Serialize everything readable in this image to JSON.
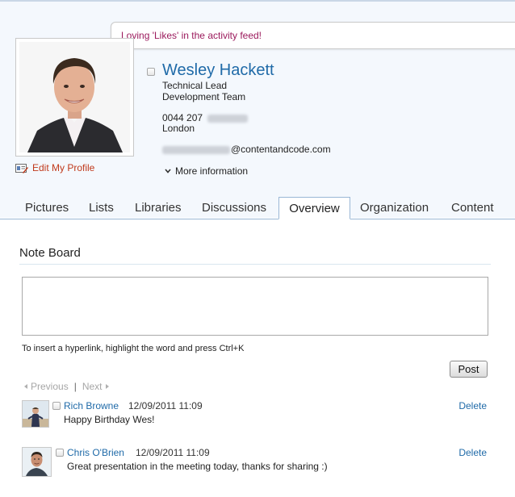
{
  "status": {
    "message": "Loving 'Likes' in the activity feed!"
  },
  "profile": {
    "name": "Wesley Hackett",
    "title": "Technical Lead",
    "department": "Development Team",
    "phone_prefix": "0044 207",
    "location": "London",
    "email_domain": "@contentandcode.com",
    "edit_label": "Edit My Profile",
    "more_info_label": "More information"
  },
  "tabs": [
    {
      "label": "Pictures",
      "active": false
    },
    {
      "label": "Lists",
      "active": false
    },
    {
      "label": "Libraries",
      "active": false
    },
    {
      "label": "Discussions",
      "active": false
    },
    {
      "label": "Overview",
      "active": true
    },
    {
      "label": "Organization",
      "active": false
    },
    {
      "label": "Content",
      "active": false
    }
  ],
  "note_board": {
    "title": "Note Board",
    "input_value": "",
    "hint": "To insert a hyperlink, highlight the word and press Ctrl+K",
    "post_label": "Post",
    "pager": {
      "previous": "Previous",
      "separator": "|",
      "next": "Next"
    },
    "notes": [
      {
        "author": "Rich Browne",
        "timestamp": "12/09/2011 11:09",
        "text": "Happy Birthday Wes!",
        "delete_label": "Delete"
      },
      {
        "author": "Chris O'Brien",
        "timestamp": "12/09/2011 11:09",
        "text": "Great presentation in the meeting today, thanks for sharing :)",
        "delete_label": "Delete"
      }
    ]
  },
  "colors": {
    "link": "#1f6aa8",
    "status_text": "#9b1a5c",
    "edit_link": "#c0391b",
    "header_bg": "#f4f8fd",
    "tab_border": "#9ab7d6"
  }
}
